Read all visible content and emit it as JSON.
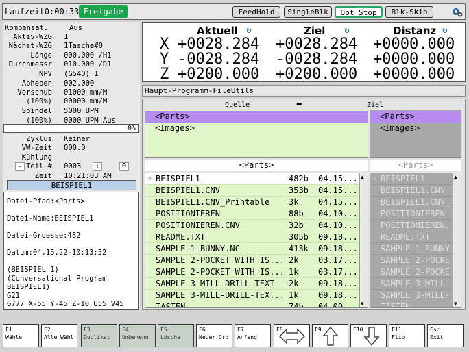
{
  "topbar": {
    "laufzeit": "Laufzeit0:00:33",
    "freigabe": "Freigabe",
    "feedhold": "FeedHold",
    "singleblk": "SingleBlk",
    "optstop": "Opt Stop",
    "blkskip": "Blk-Skip"
  },
  "status": {
    "kompensat_k": "Kompensat.",
    "kompensat_v": "Aus",
    "aktiv_k": "Aktiv-WZG",
    "aktiv_v": "1",
    "naechst_k": "Nächst-WZG",
    "naechst_v": "1Tasche#0",
    "laenge_k": "Länge",
    "laenge_v": "000.000 /H1",
    "durch_k": "Durchmessr",
    "durch_v": "010.000 /D1",
    "npv_k": "NPV",
    "npv_v": "(G540) 1",
    "abheben_k": "Abheben",
    "abheben_v": "002.000",
    "vorschub_k": "Vorschub",
    "vorschub_v": "01000 mm/M",
    "vpct_k": "(100%)",
    "vpct_v": "00000 mm/M",
    "spindel_k": "Spindel",
    "spindel_v": "5000 UPM",
    "spct_k": "(100%)",
    "spct_v": "0000 UPM Aus",
    "progress": "0%",
    "zyklus_k": "Zyklus",
    "zyklus_v": "Keiner",
    "vwzeit_k": "VW-Zeit",
    "vwzeit_v": "000.0",
    "kuehlung_k": "Kühlung",
    "teil_minus": "-",
    "teil_k": "Teil #",
    "teil_v": "0003",
    "teil_plus": "+",
    "teil_zero": "0",
    "zeit_k": "Zeit",
    "zeit_v": "10:21:03 AM",
    "program": "BEISPIEL1"
  },
  "info": "Datei-Pfad:<Parts>\n\nDatei-Name:BEISPIEL1\n\nDatei-Groesse:482\n\nDatum:04.15.22-10:13:52\n\n(BEISPIEL 1)\n(Conversational Program\nBEISPIEL1)\nG21\nG777 X-55 Y-45 Z-10 U55 V45",
  "coords": {
    "h_aktuell": "Aktuell",
    "h_ziel": "Ziel",
    "h_distanz": "Distanz",
    "rows": [
      {
        "axis": "X",
        "aktuell": "+0028.284",
        "ziel": "+0028.284",
        "distanz": "+0000.000"
      },
      {
        "axis": "Y",
        "aktuell": "-0028.284",
        "ziel": "-0028.284",
        "distanz": "+0000.000"
      },
      {
        "axis": "Z",
        "aktuell": "+0200.000",
        "ziel": "+0200.000",
        "distanz": "+0000.000"
      }
    ]
  },
  "fileutils": "Haupt-Programm-FileUtils",
  "browser": {
    "quelle": "Quelle",
    "ziel": "Ziel",
    "arrow": "➡",
    "src_dirs": [
      "<Parts>",
      "<Images>"
    ],
    "dst_dirs": [
      "<Parts>",
      "<Images>"
    ],
    "src_path": "<Parts>",
    "dst_path": "<Parts>",
    "files": [
      {
        "name": "BEISPIEL1",
        "size": "482b",
        "date": "04.15..."
      },
      {
        "name": "BEISPIEL1.CNV",
        "size": "353b",
        "date": "04.15..."
      },
      {
        "name": "BEISPIEL1.CNV_Printable",
        "size": "3k",
        "date": "04.15..."
      },
      {
        "name": "POSITIONIEREN",
        "size": "88b",
        "date": "04.10..."
      },
      {
        "name": "POSITIONIEREN.CNV",
        "size": "32b",
        "date": "04.10..."
      },
      {
        "name": "README.TXT",
        "size": "305b",
        "date": "09.18..."
      },
      {
        "name": "SAMPLE 1-BUNNY.NC",
        "size": "413k",
        "date": "09.18..."
      },
      {
        "name": "SAMPLE 2-POCKET WITH IS...",
        "size": "2k",
        "date": "03.17..."
      },
      {
        "name": "SAMPLE 2-POCKET WITH IS...",
        "size": "1k",
        "date": "03.17..."
      },
      {
        "name": "SAMPLE 3-MILL-DRILL-TEXT",
        "size": "2k",
        "date": "09.18..."
      },
      {
        "name": "SAMPLE 3-MILL-DRILL-TEX...",
        "size": "1k",
        "date": "09.18..."
      },
      {
        "name": "TASTEN",
        "size": "74b",
        "date": "04.09..."
      }
    ],
    "dst_files": [
      "BEISPIEL1",
      "BEISPIEL1.CNV",
      "BEISPIEL1.CNV_",
      "POSITIONIEREN",
      "POSITIONIEREN.",
      "README.TXT",
      "SAMPLE 1-BUNNY",
      "SAMPLE 2-POCKE",
      "SAMPLE 2-POCKE",
      "SAMPLE 3-MILL-",
      "SAMPLE 3-MILL-",
      "TASTEN"
    ]
  },
  "fkeys": [
    {
      "n": "F1",
      "l": "Wähle"
    },
    {
      "n": "F2",
      "l": "Alle Wähl"
    },
    {
      "n": "F3",
      "l": "Duplikat"
    },
    {
      "n": "F4",
      "l": "Umbenenn"
    },
    {
      "n": "F5",
      "l": "Lösche"
    },
    {
      "n": "F6",
      "l": "Neuer Ord"
    },
    {
      "n": "F7",
      "l": "Anfang"
    },
    {
      "n": "F8",
      "l": ""
    },
    {
      "n": "F9",
      "l": ""
    },
    {
      "n": "F10",
      "l": ""
    },
    {
      "n": "F11",
      "l": "Flip"
    },
    {
      "n": "Esc",
      "l": "Exit"
    }
  ]
}
